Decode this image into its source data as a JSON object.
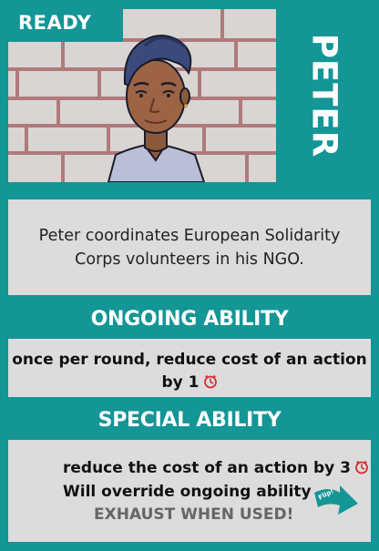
{
  "card": {
    "status": "READY",
    "character_name": "PETER",
    "description": "Peter coordinates European Solidarity Corps volunteers in his NGO.",
    "ongoing": {
      "title": "ONGOING ABILITY",
      "text": "once per round, reduce cost of an action by 1"
    },
    "special": {
      "title": "SPECIAL ABILITY",
      "line1": "reduce the cost of an action by 3",
      "line2": "Will override ongoing ability",
      "line3": "EXHAUST WHEN USED!",
      "flip_label": "Flip!"
    }
  },
  "icons": {
    "cost": "clock-icon",
    "flip": "flip-arrow-icon"
  },
  "colors": {
    "background": "#149596",
    "panel": "#dcdcdc",
    "clock": "#d32f2f",
    "portrait_wall": "#d9d5d3",
    "brick_lines": "#b07a7a"
  }
}
